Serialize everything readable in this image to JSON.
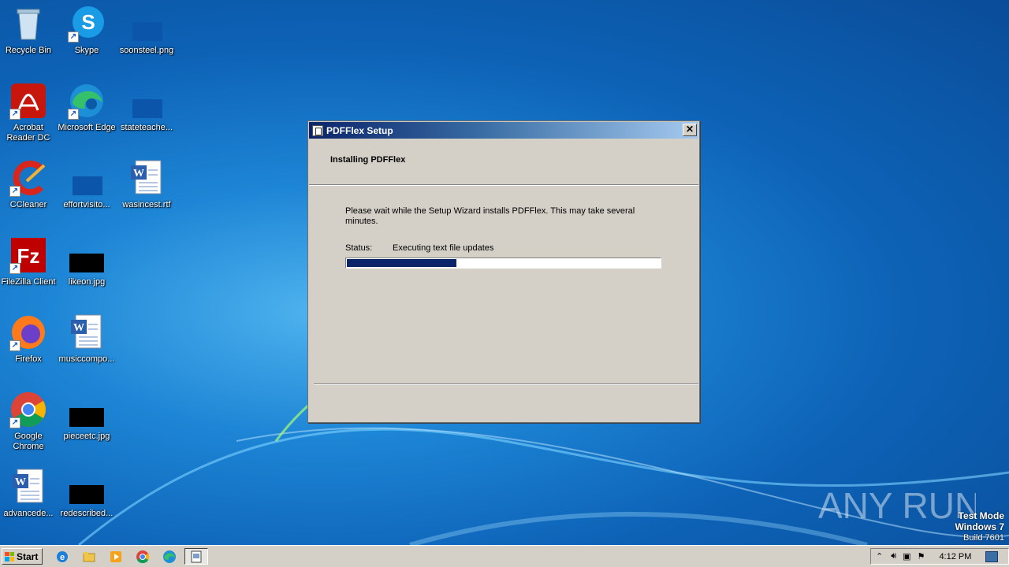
{
  "desktop": {
    "icons": [
      {
        "label": "Recycle Bin"
      },
      {
        "label": "Skype"
      },
      {
        "label": "soonsteel.png"
      },
      {
        "label": "Acrobat Reader DC"
      },
      {
        "label": "Microsoft Edge"
      },
      {
        "label": "stateteache..."
      },
      {
        "label": "CCleaner"
      },
      {
        "label": "effortvisito..."
      },
      {
        "label": "wasincest.rtf"
      },
      {
        "label": "FileZilla Client"
      },
      {
        "label": "likeon.jpg"
      },
      {
        "label": "Firefox"
      },
      {
        "label": "musiccompo..."
      },
      {
        "label": "Google Chrome"
      },
      {
        "label": "pieceetc.jpg"
      },
      {
        "label": "advancede..."
      },
      {
        "label": "redescribed..."
      }
    ]
  },
  "dialog": {
    "title": "PDFFlex Setup",
    "close_glyph": "✕",
    "heading": "Installing PDFFlex",
    "message": "Please wait while the Setup Wizard installs PDFFlex.  This may take several minutes.",
    "status_label": "Status:",
    "status_value": "Executing text file updates",
    "progress_fraction": 0.35
  },
  "taskbar": {
    "start_label": "Start",
    "clock": "4:12 PM",
    "pinned": [
      "internet-explorer",
      "file-explorer",
      "media-player",
      "chrome",
      "edge",
      "setup"
    ]
  },
  "watermark": {
    "text": "ANY RUN"
  },
  "os_notice": {
    "line1": "Test Mode",
    "line2": "Windows 7",
    "line3": "Build 7601"
  },
  "colors": {
    "accent": "#0a246a",
    "desktop": "#0d62b6",
    "taskbar": "#d4d0c8"
  }
}
